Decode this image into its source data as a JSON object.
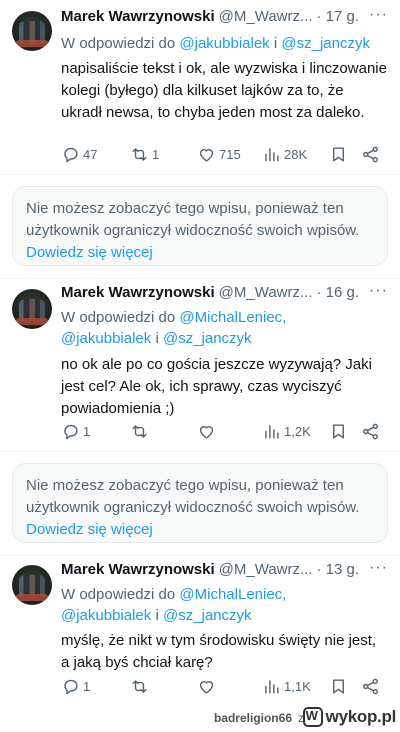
{
  "tweets": [
    {
      "name": "Marek Wawrzynowski",
      "handle": "@M_Wawrz...",
      "time": "· 17 g.",
      "reply_prefix": "W odpowiedzi do",
      "reply_mentions": [
        "@jakubbialek",
        "@sz_janczyk"
      ],
      "reply_joiner": "i",
      "text": "napisaliście tekst i ok, ale wyzwiska i linczowanie kolegi (byłego) dla kilkuset lajków za to, że ukradł newsa, to chyba jeden most za daleko.",
      "replies": "47",
      "retweets": "1",
      "likes": "715",
      "views": "28K"
    },
    {
      "name": "Marek Wawrzynowski",
      "handle": "@M_Wawrz...",
      "time": "· 16 g.",
      "reply_prefix": "W odpowiedzi do",
      "reply_mentions": [
        "@MichalLeniec,",
        "@jakubbialek",
        "@sz_janczyk"
      ],
      "reply_joiner": "i",
      "text": "no ok ale po co gościa jeszcze wyzywają? Jaki jest cel? Ale ok, ich sprawy, czas wyciszyć powiadomienia ;)",
      "replies": "1",
      "retweets": "",
      "likes": "",
      "views": "1,2K"
    },
    {
      "name": "Marek Wawrzynowski",
      "handle": "@M_Wawrz...",
      "time": "· 13 g.",
      "reply_prefix": "W odpowiedzi do",
      "reply_mentions": [
        "@MichalLeniec,",
        "@jakubbialek",
        "@sz_janczyk"
      ],
      "reply_joiner": "i",
      "text": "myślę, że nikt w tym środowisku święty nie jest, a jaką byś chciał karę?",
      "replies": "1",
      "retweets": "",
      "likes": "",
      "views": "1,1K"
    }
  ],
  "notice": {
    "text": "Nie możesz zobaczyć tego wpisu, ponieważ ten użytkownik ograniczył widoczność swoich wpisów.",
    "link": "Dowiedz się więcej"
  },
  "footer": {
    "user": "badreligion66",
    "joiner": "z",
    "site": "wykop.pl"
  },
  "icons": [
    "more-icon",
    "reply-icon",
    "retweet-icon",
    "like-icon",
    "views-icon",
    "bookmark-icon",
    "share-icon"
  ],
  "colors": {
    "link": "#1d9bf0",
    "muted": "#536471",
    "text": "#0f1419"
  }
}
